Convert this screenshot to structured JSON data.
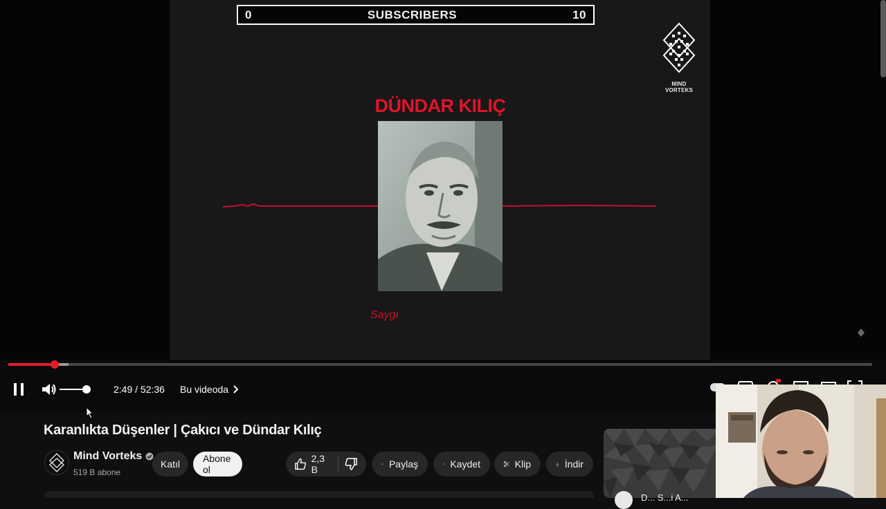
{
  "overlay": {
    "subs_left": "0",
    "subs_label": "SUBSCRIBERS",
    "subs_right": "10",
    "brand_text": "MIND VORTEKS"
  },
  "video_content": {
    "person_name": "DÜNDAR KILIÇ",
    "caption": "Saygı"
  },
  "player": {
    "progress_fraction": 0.0537,
    "buffer_fraction": 0.07,
    "volume_fraction": 1.0,
    "time": "2:49 / 52:36",
    "chapter_label": "Bu videoda",
    "colors": {
      "progress": "#e11d2b",
      "accent_red": "#e0142b"
    }
  },
  "video": {
    "title": "Karanlıkta Düşenler | Çakıcı ve Dündar Kılıç"
  },
  "channel": {
    "name": "Mind Vorteks",
    "subscribers": "519 B abone",
    "join_label": "Katıl",
    "subscribe_label": "Abone ol"
  },
  "actions": {
    "like_count": "2,3 B",
    "share_label": "Paylaş",
    "save_label": "Kaydet",
    "clip_label": "Klip",
    "download_label": "İndir"
  },
  "recommendation": {
    "title_partial": "D...   S...i A..."
  }
}
